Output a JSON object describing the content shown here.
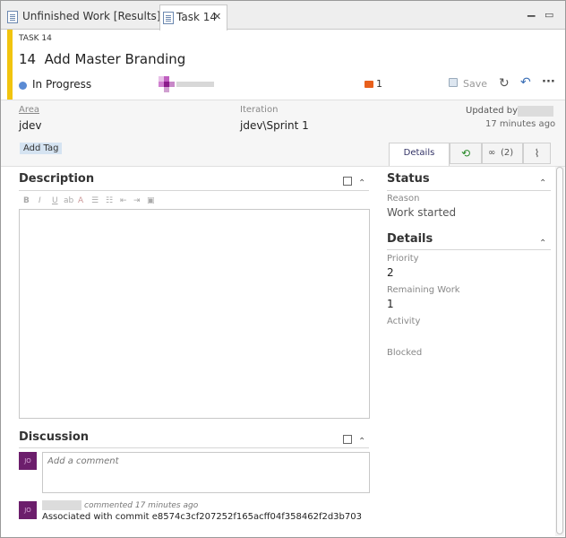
{
  "tabs": [
    {
      "label": "Unfinished Work [Results]",
      "icon": "query-results-icon",
      "active": false
    },
    {
      "label": "Task 14",
      "icon": "work-item-icon",
      "active": true
    }
  ],
  "work_item": {
    "type_label": "TASK 14",
    "id": "14",
    "title": "Add Master Branding",
    "state": "In Progress",
    "state_color": "#5b8bd4",
    "comment_count": "1",
    "save_label": "Save"
  },
  "fields": {
    "area_label": "Area",
    "area_value": "jdev",
    "iteration_label": "Iteration",
    "iteration_value": "jdev\\Sprint 1",
    "updated_by_label": "Updated by",
    "updated_time": "17 minutes ago",
    "add_tag_label": "Add Tag"
  },
  "right_tabs": {
    "details_label": "Details",
    "links_count": "(2)"
  },
  "description": {
    "title": "Description"
  },
  "status": {
    "title": "Status",
    "reason_label": "Reason",
    "reason_value": "Work started"
  },
  "details": {
    "title": "Details",
    "priority_label": "Priority",
    "priority_value": "2",
    "remaining_label": "Remaining Work",
    "remaining_value": "1",
    "activity_label": "Activity",
    "blocked_label": "Blocked"
  },
  "discussion": {
    "title": "Discussion",
    "placeholder": "Add a comment",
    "avatar_initials": "JO",
    "comment_meta": "commented 17 minutes ago",
    "comment_text": "Associated with commit e8574c3cf207252f165acff04f358462f2d3b703"
  },
  "colors": {
    "accent_yellow": "#f1c40f",
    "avatar": "#6c1e6c",
    "comment_icon": "#e8601c"
  }
}
